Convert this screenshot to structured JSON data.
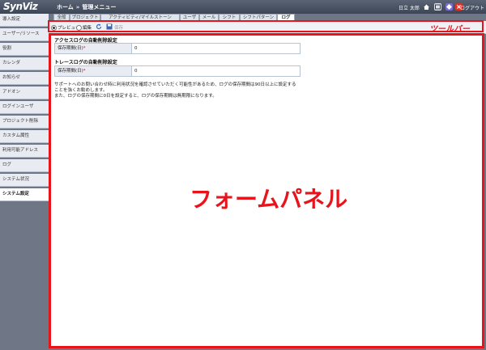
{
  "header": {
    "logo": "SynViz",
    "crumb_home": "ホーム",
    "crumb_sep": "»",
    "crumb_admin": "管理メニュー",
    "user": "日立 太郎",
    "logout": "ログアウト"
  },
  "sidebar": {
    "items": [
      {
        "label": "導入設定"
      },
      {
        "label": "ユーザー/リソース"
      },
      {
        "label": "役割"
      },
      {
        "label": "カレンダ"
      },
      {
        "label": "お知らせ"
      },
      {
        "label": "アドオン"
      },
      {
        "label": "ログインユーザ"
      },
      {
        "label": "プロジェクト削除"
      },
      {
        "label": "カスタム属性"
      },
      {
        "label": "利用可能アドレス"
      },
      {
        "label": "ログ"
      },
      {
        "label": "システム状況"
      },
      {
        "label": "システム設定"
      }
    ]
  },
  "tabs": [
    {
      "label": "全般"
    },
    {
      "label": "プロジェクト"
    },
    {
      "label": "アクティビティ/マイルストーン"
    },
    {
      "label": "ユーザ"
    },
    {
      "label": "メール"
    },
    {
      "label": "シフト"
    },
    {
      "label": "シフトパターン"
    },
    {
      "label": "ログ"
    }
  ],
  "toolbar": {
    "preview": "プレビュー",
    "edit": "編集",
    "save": "保存"
  },
  "annotations": {
    "toolbar": "ツールバー",
    "form": "フォームパネル"
  },
  "form": {
    "access_title": "アクセスログの自動削除設定",
    "access_label": "保存期間(日)",
    "access_value": "0",
    "trace_title": "トレースログの自動削除設定",
    "trace_label": "保存期間(日)",
    "trace_value": "0",
    "required_mark": "*",
    "note1": "サポートへのお問い合わせ時に利用状況を確認させていただく可能性があるため、ログの保存期間は90日以上に設定する",
    "note2": "ことを強くお勧めします。",
    "note3": "また、ログの保存期間に0日を設定すると、ログの保存期間は無期限になります。"
  },
  "colors": {
    "annotation_red": "#e8141b",
    "header_bg": "#4a5364",
    "sidebar_bg": "#6f7787"
  }
}
